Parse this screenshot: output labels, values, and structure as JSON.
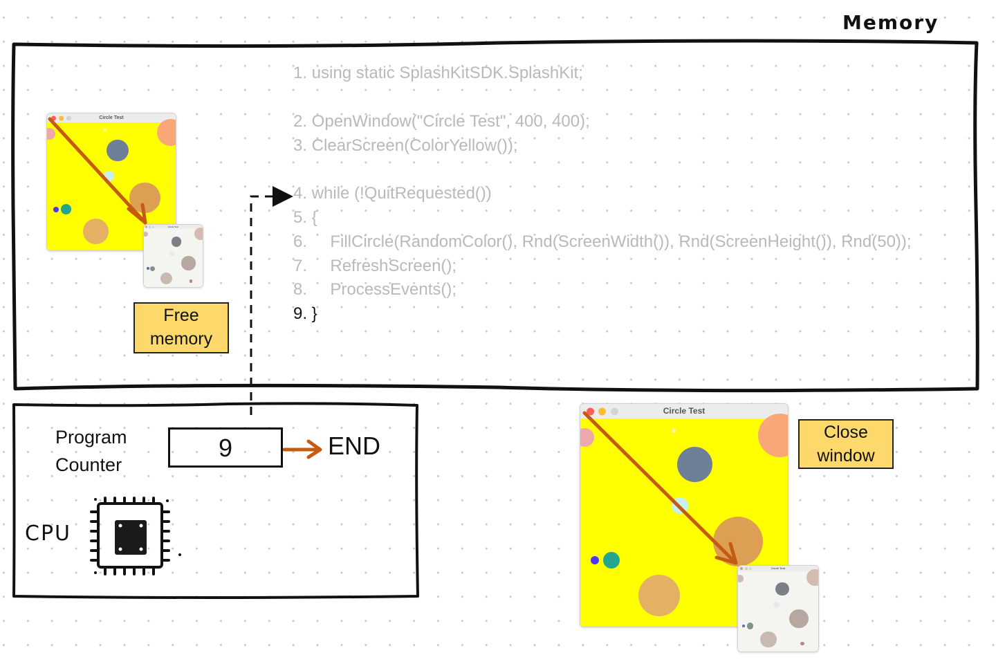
{
  "memory": {
    "title": "Memory",
    "code_lines": [
      {
        "text": "1. using static SplashKitSDK.SplashKit;",
        "active": false
      },
      {
        "text": "2. OpenWindow(\"Circle Test\", 400, 400);",
        "active": false
      },
      {
        "text": "3. ClearScreen(ColorYellow());",
        "active": false
      },
      {
        "text": "4. while (!QuitRequested())",
        "active": false
      },
      {
        "text": "5. {",
        "active": false
      },
      {
        "text": "6.     FillCircle(RandomColor(), Rnd(ScreenWidth()), Rnd(ScreenHeight()), Rnd(50));",
        "active": false
      },
      {
        "text": "7.     RefreshScreen();",
        "active": false
      },
      {
        "text": "8.     ProcessEvents();",
        "active": false
      },
      {
        "text": "9. }",
        "active": true
      }
    ],
    "free_memory_note": {
      "line1": "Free",
      "line2": "memory"
    }
  },
  "cpu": {
    "program_counter_label": {
      "line1": "Program",
      "line2": "Counter"
    },
    "program_counter_value": "9",
    "end_label": "END",
    "cpu_label": "CPU"
  },
  "close_window_note": {
    "line1": "Close",
    "line2": "window"
  },
  "window": {
    "title": "Circle Test",
    "background_color": "#ffff00",
    "faded_background_color": "#f4f4f0",
    "circles": [
      {
        "color": "#eda8ac",
        "faded": "#cfb9bb",
        "cx": 0.02,
        "cy": 0.09,
        "r": 0.045
      },
      {
        "color": "#f9a777",
        "faded": "#d3bdb3",
        "cx": 0.96,
        "cy": 0.08,
        "r": 0.105
      },
      {
        "color": "#6e7f98",
        "faded": "#7b7f86",
        "cx": 0.55,
        "cy": 0.22,
        "r": 0.085
      },
      {
        "color": "#c8f0ee",
        "faded": "#e3ebeb",
        "cx": 0.48,
        "cy": 0.42,
        "r": 0.04
      },
      {
        "color": "#dc9f54",
        "faded": "#b6a8a0",
        "cx": 0.76,
        "cy": 0.59,
        "r": 0.12
      },
      {
        "color": "#4d36fb",
        "faded": "#6a66a8",
        "cx": 0.07,
        "cy": 0.68,
        "r": 0.02
      },
      {
        "color": "#22a68e",
        "faded": "#7e948c",
        "cx": 0.15,
        "cy": 0.68,
        "r": 0.04
      },
      {
        "color": "#e4b064",
        "faded": "#c8bab2",
        "cx": 0.38,
        "cy": 0.85,
        "r": 0.1
      },
      {
        "color": "#faf5c0",
        "faded": "#e9e9e9",
        "cx": 0.45,
        "cy": 0.06,
        "r": 0.01
      }
    ],
    "faded_extra": {
      "color": "#b58690",
      "cx": 0.8,
      "cy": 0.9,
      "r": 0.025
    }
  },
  "colors": {
    "arrow": "#c55a11",
    "note_fill": "#fdd86a",
    "ink": "#111111",
    "code_inactive": "#b9b9b9"
  }
}
